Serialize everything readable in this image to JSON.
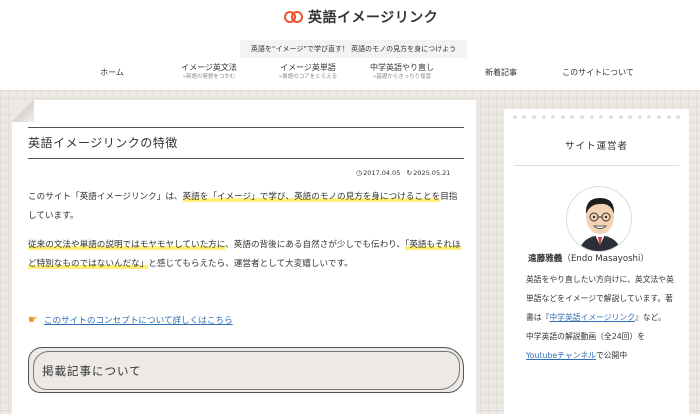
{
  "header": {
    "logo_text": "英語イメージリンク",
    "tagline": "英語を“イメージ”で学び直す！ 英語のモノの見方を身につけよう"
  },
  "nav": [
    {
      "label": "ホーム",
      "sub": ""
    },
    {
      "label": "イメージ英文法",
      "sub": "»英語の発想をつかむ"
    },
    {
      "label": "イメージ英単語",
      "sub": "»単語のコアをとらえる"
    },
    {
      "label": "中学英語やり直し",
      "sub": "»基礎からきっちり復習"
    },
    {
      "label": "新着記事",
      "sub": ""
    },
    {
      "label": "このサイトについて",
      "sub": ""
    }
  ],
  "article": {
    "title": "英語イメージリンクの特徴",
    "date_published": "2017.04.05",
    "date_updated": "2025.05.21",
    "p1_a": "このサイト「英語イメージリンク」は、",
    "p1_hl": "英語を「イメージ」で学び、英語のモノの見方を身につけることを",
    "p1_b": "目指しています。",
    "p2_hl": "従来の文法や単語の説明ではモヤモヤしていた方に",
    "p2_a": "、英語の背後にある自然さが少しでも伝わり、",
    "p2_hl2": "「英語もそれほど特別なものではないんだな」",
    "p2_b": "と感じてもらえたら、運営者として大変嬉しいです。",
    "concept_link": "このサイトのコンセプトについて詳しくはこちら",
    "section_heading": "掲載記事について"
  },
  "sidebar": {
    "title": "サイト運営者",
    "author_name": "遠藤雅義",
    "author_romaji": "（Endo Masayoshi）",
    "bio_a": "英語をやり直したい方向けに、英文法や英単語などをイメージで解説しています。著書は『",
    "bio_link1": "中学英語イメージリンク",
    "bio_b": "』など。",
    "bio_c": "中学英語の解説動画（全24回）を",
    "bio_link2": "Youtubeチャンネル",
    "bio_d": "で公開中"
  },
  "colors": {
    "accent": "#e8542e",
    "link": "#2f6fb6",
    "highlight": "#fff07a",
    "background": "#ece8e3"
  }
}
